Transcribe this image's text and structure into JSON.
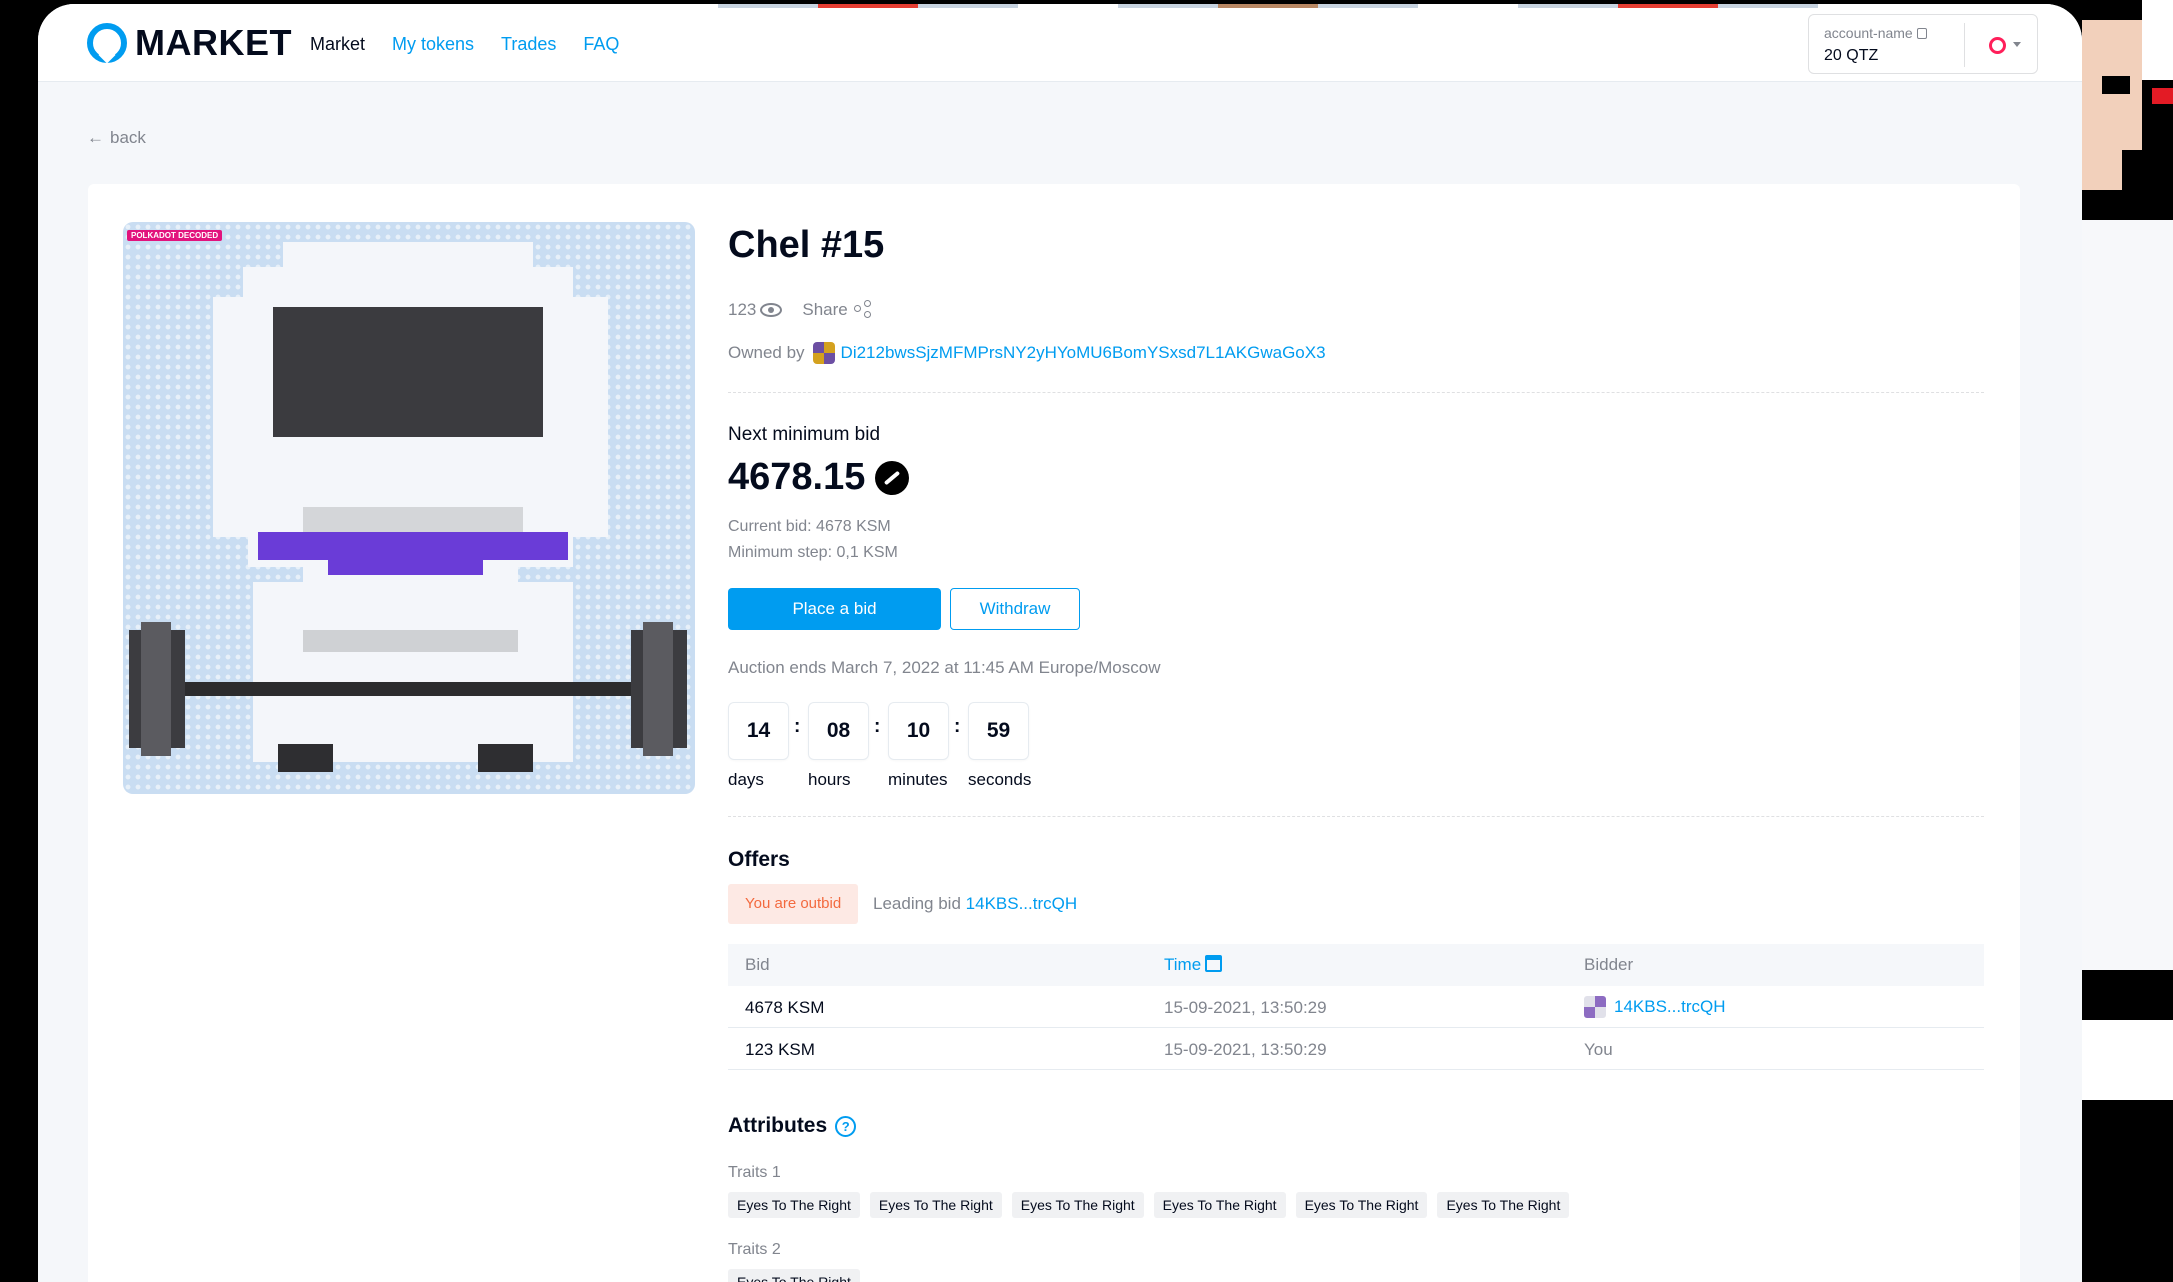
{
  "header": {
    "logo_text": "MARKET",
    "nav": [
      {
        "label": "Market",
        "active": true
      },
      {
        "label": "My tokens",
        "active": false
      },
      {
        "label": "Trades",
        "active": false
      },
      {
        "label": "FAQ",
        "active": false
      }
    ],
    "account": {
      "name": "account-name",
      "balance": "20 QTZ"
    }
  },
  "back_label": "back",
  "token": {
    "badge": "POLKADOT DECODED",
    "title": "Chel #15",
    "views": "123",
    "share_label": "Share",
    "owned_by_label": "Owned by",
    "owner_address": "Di212bwsSjzMFMPrsNY2yHYoMU6BomYSxsd7L1AKGwaGoX3"
  },
  "bid": {
    "next_min_label": "Next minimum bid",
    "next_min_value": "4678.15",
    "current_bid": "Current bid: 4678 KSM",
    "min_step": "Minimum step: 0,1 KSM",
    "place_bid_label": "Place a bid",
    "withdraw_label": "Withdraw",
    "auction_ends": "Auction ends March 7, 2022 at 11:45 AM Europe/Moscow"
  },
  "countdown": {
    "days": "14",
    "hours": "08",
    "minutes": "10",
    "seconds": "59",
    "labels": {
      "days": "days",
      "hours": "hours",
      "minutes": "minutes",
      "seconds": "seconds"
    }
  },
  "offers": {
    "title": "Offers",
    "outbid_label": "You are outbid",
    "leading_label": "Leading bid",
    "leading_address": "14KBS...trcQH",
    "columns": {
      "bid": "Bid",
      "time": "Time",
      "bidder": "Bidder"
    },
    "rows": [
      {
        "bid": "4678 KSM",
        "time": "15-09-2021, 13:50:29",
        "bidder": "14KBS...trcQH"
      },
      {
        "bid": "123 KSM",
        "time": "15-09-2021, 13:50:29",
        "bidder": "You"
      }
    ]
  },
  "attributes": {
    "title": "Attributes",
    "help": "?",
    "groups": [
      {
        "label": "Traits 1",
        "chips": [
          "Eyes To The Right",
          "Eyes To The Right",
          "Eyes To The Right",
          "Eyes To The Right",
          "Eyes To The Right",
          "Eyes To The Right"
        ]
      },
      {
        "label": "Traits 2",
        "chips": [
          "Eyes To The Right"
        ]
      }
    ]
  },
  "colors": {
    "accent": "#009cf0",
    "text": "#040b1d",
    "muted": "#81858e",
    "outbid_bg": "#fde9e4",
    "outbid_text": "#f36a3f"
  }
}
